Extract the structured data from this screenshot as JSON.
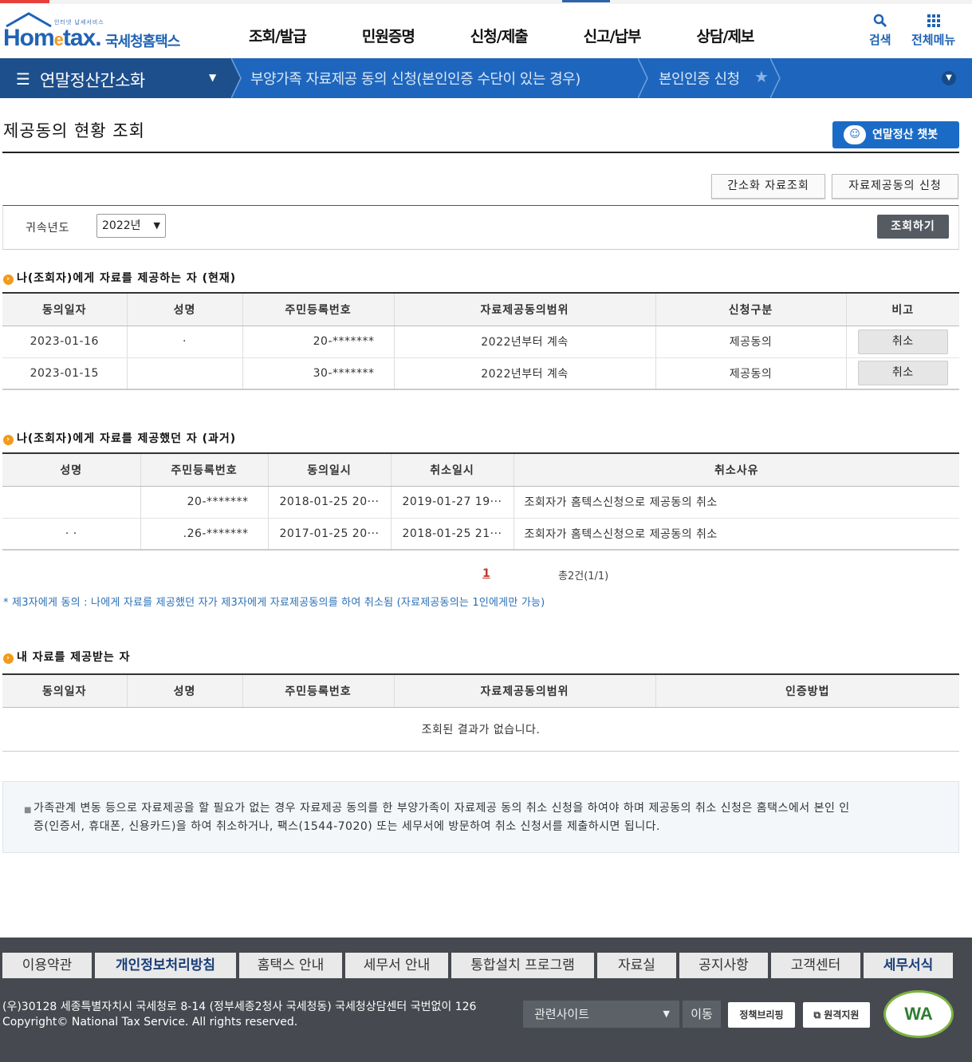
{
  "header": {
    "logo_small": "인터넷 납세서비스",
    "logo_home": "Hom",
    "logo_e": "e",
    "logo_tax": "tax.",
    "logo_kr": "국세청홈택스",
    "gnb": [
      "조회/발급",
      "민원증명",
      "신청/제출",
      "신고/납부",
      "상담/제보"
    ],
    "search_label": "검색",
    "menu_label": "전체메뉴"
  },
  "nav": {
    "home_title": "연말정산간소화",
    "seg1": "부양가족 자료제공 동의 신청(본인인증 수단이 있는 경우)",
    "seg2": "본인인증 신청"
  },
  "page": {
    "title": "제공동의 현황 조회",
    "chatbot": "연말정산 챗봇",
    "btn_simple": "간소화 자료조회",
    "btn_apply": "자료제공동의 신청"
  },
  "search": {
    "label": "귀속년도",
    "year": "2022년",
    "submit": "조회하기"
  },
  "current": {
    "title": "나(조회자)에게 자료를 제공하는 자 (현재)",
    "headers": [
      "동의일자",
      "성명",
      "주민등록번호",
      "자료제공동의범위",
      "신청구분",
      "비고"
    ],
    "rows": [
      {
        "date": "2023-01-16",
        "name": "·",
        "rrn": "20-*******",
        "scope": "2022년부터 계속",
        "type": "제공동의",
        "action": "취소"
      },
      {
        "date": "2023-01-15",
        "name": "",
        "rrn": "30-*******",
        "scope": "2022년부터 계속",
        "type": "제공동의",
        "action": "취소"
      }
    ]
  },
  "past": {
    "title": "나(조회자)에게 자료를 제공했던 자 (과거)",
    "headers": [
      "성명",
      "주민등록번호",
      "동의일시",
      "취소일시",
      "취소사유"
    ],
    "rows": [
      {
        "name": "",
        "rrn": "20-*******",
        "agree": "2018-01-25 20···",
        "cancel": "2019-01-27 19···",
        "reason": "조회자가 홈텍스신청으로 제공동의 취소"
      },
      {
        "name": "· ·",
        "rrn": ".26-*******",
        "agree": "2017-01-25 20···",
        "cancel": "2018-01-25 21···",
        "reason": "조회자가 홈텍스신청으로 제공동의 취소"
      }
    ],
    "page": "1",
    "total": "총2건(1/1)"
  },
  "note": "* 제3자에게 동의 : 나에게 자료를 제공했던 자가 제3자에게 자료제공동의를 하여 취소됨 (자료제공동의는 1인에게만 가능)",
  "receive": {
    "title": "내 자료를 제공받는 자",
    "headers": [
      "동의일자",
      "성명",
      "주민등록번호",
      "자료제공동의범위",
      "인증방법"
    ],
    "empty": "조회된 결과가 없습니다."
  },
  "info": {
    "line1": "가족관계 변동 등으로 자료제공을 할 필요가 없는 경우 자료제공 동의를 한 부양가족이 자료제공 동의 취소 신청을 하여야 하며 제공동의 취소 신청은 홈택스에서 본인 인",
    "line2": "증(인증서, 휴대폰, 신용카드)을 하여 취소하거나, 팩스(1544-7020) 또는 세무서에 방문하여 취소 신청서를 제출하시면 됩니다."
  },
  "footer": {
    "links": [
      "이용약관",
      "개인정보처리방침",
      "홈택스 안내",
      "세무서 안내",
      "통합설치 프로그램",
      "자료실",
      "공지사항",
      "고객센터",
      "세무서식"
    ],
    "address": "(우)30128 세종특별자치시 국세청로 8-14 (정부세종2청사 국세청동) 국세청상담센터 국번없이 126",
    "copyright": "Copyright© National Tax Service. All rights reserved.",
    "related": "관련사이트",
    "move": "이동",
    "btn_policy": "정책브리핑",
    "btn_remote": "원격지원",
    "wa": "WA"
  },
  "colors": {
    "primary": "#1e66bd",
    "nav_dark": "#1d4f8d",
    "accent": "#f39a1e",
    "footer": "#46494f"
  }
}
